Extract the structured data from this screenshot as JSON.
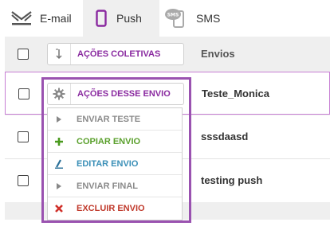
{
  "tabs": [
    {
      "label": "E-mail",
      "icon": "email-icon"
    },
    {
      "label": "Push",
      "icon": "phone-icon",
      "active": true
    },
    {
      "label": "SMS",
      "icon": "sms-icon"
    }
  ],
  "table": {
    "header": {
      "actions_label": "AÇÕES COLETIVAS",
      "column_name": "Envios"
    },
    "rows": [
      {
        "name": "Teste_Monica"
      },
      {
        "name": "sssdaasd"
      },
      {
        "name": "testing push"
      }
    ]
  },
  "row_actions": {
    "button_label": "AÇÕES DESSE ENVIO",
    "items": [
      {
        "label": "ENVIAR TESTE",
        "icon": "play-icon",
        "color": "#8a8a8a"
      },
      {
        "label": "COPIAR ENVIO",
        "icon": "plus-icon",
        "color": "#5aa02c"
      },
      {
        "label": "EDITAR ENVIO",
        "icon": "edit-icon",
        "color": "#3a8fb7"
      },
      {
        "label": "ENVIAR FINAL",
        "icon": "play-icon",
        "color": "#8a8a8a"
      },
      {
        "label": "EXCLUIR ENVIO",
        "icon": "close-icon",
        "color": "#c0392b"
      }
    ]
  },
  "colors": {
    "accent": "#8a2aa0",
    "highlight_border": "#9a52b0"
  }
}
